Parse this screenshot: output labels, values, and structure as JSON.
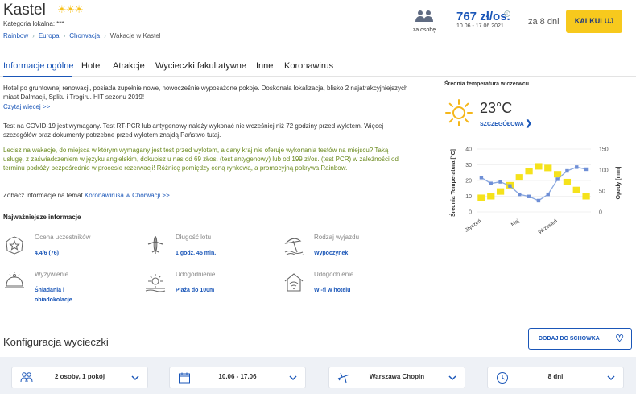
{
  "header": {
    "title": "Kastel",
    "stars": "☀☀☀",
    "category": "Kategoria lokalna: ***",
    "breadcrumb": [
      "Rainbow",
      "Europa",
      "Chorwacja",
      "Wakacje w Kastel"
    ],
    "persons_label": "za osobę",
    "price": "767 zł/os.",
    "dates": "10.06 - 17.06.2021",
    "days": "za 8 dni",
    "calc_button": "KALKULUJ"
  },
  "tabs": [
    "Informacje ogólne",
    "Hotel",
    "Atrakcje",
    "Wycieczki fakultatywne",
    "Inne",
    "Koronawirus"
  ],
  "info": {
    "para1": "Hotel po gruntownej renowacji, posiada zupełnie nowe, nowocześnie wyposażone pokoje. Doskonała lokalizacja, blisko 2 najatrakcyjniejszych miast Dalmacji, Splitu i Trogiru. HIT sezonu 2019!",
    "read_more": "Czytaj więcej >>",
    "para2": "Test na COVID-19 jest wymagany. Test RT-PCR lub antygenowy należy wykonać nie wcześniej niż 72 godziny przed wylotem. Więcej szczegółów oraz dokumenty potrzebne przed wylotem znajdą Państwo tutaj.",
    "para3": "Lecisz na wakacje, do miejsca w którym wymagany jest test przed wylotem, a dany kraj nie oferuje wykonania testów na miejscu? Taką usługę, z zaświadczeniem w języku angielskim, dokupisz u nas od 69 zł/os. (test antygenowy) lub od 199 zł/os. (test PCR) w zależności od terminu podróży bezpośrednio w procesie rezerwacji! Różnicę pomiędzy ceną rynkową, a promocyjną pokrywa Rainbow.",
    "covid_prefix": "Zobacz informacje na temat ",
    "covid_link": "Koronawirusa w Chorwacji >>"
  },
  "key_info": {
    "title": "Najważniejsze informacje",
    "items": [
      {
        "label": "Ocena uczestników",
        "value": "4.4/6 (76)",
        "icon": "star-rating-icon"
      },
      {
        "label": "Długość lotu",
        "value": "1 godz. 45 min.",
        "icon": "airplane-icon"
      },
      {
        "label": "Rodzaj wyjazdu",
        "value": "Wypoczynek",
        "icon": "beach-umbrella-icon"
      },
      {
        "label": "Wyżywienie",
        "value": "Śniadania i obiadokolacje",
        "icon": "food-cloche-icon"
      },
      {
        "label": "Udogodnienie",
        "value": "Plaża do 100m",
        "icon": "beach-sun-icon"
      },
      {
        "label": "Udogodnienie",
        "value": "Wi-fi w hotelu",
        "icon": "wifi-house-icon"
      }
    ]
  },
  "weather": {
    "title": "Średnia temperatura w czerwcu",
    "temperature": "23°C",
    "details_link": "SZCZEGÓŁOWA"
  },
  "chart_data": {
    "type": "bar",
    "categories": [
      "1",
      "2",
      "3",
      "4",
      "5",
      "6",
      "7",
      "8",
      "9",
      "10",
      "11",
      "12"
    ],
    "tick_labels": [
      "Styczeń",
      "Maj",
      "Wrzesień"
    ],
    "tick_positions": [
      1,
      5,
      9
    ],
    "ylabel_left": "Średnia Temperatura [°C]",
    "ylabel_right": "Opady [mm]",
    "ylim_left": [
      0,
      40
    ],
    "ylim_right": [
      0,
      150
    ],
    "yticks_left": [
      0,
      10,
      20,
      30,
      40
    ],
    "yticks_right": [
      0,
      50,
      100,
      150
    ],
    "series": [
      {
        "type": "bar",
        "axis": "left",
        "color": "#f5e21b",
        "values": [
          9,
          10,
          13,
          17,
          22,
          26,
          29,
          28,
          24,
          19,
          14,
          10
        ]
      },
      {
        "type": "line",
        "axis": "right",
        "color": "#8aa8e0",
        "values": [
          82,
          68,
          72,
          62,
          42,
          37,
          27,
          42,
          78,
          98,
          107,
          102
        ]
      }
    ]
  },
  "config": {
    "title": "Konfiguracja wycieczki",
    "add_button": "DODAJ DO SCHOWKA",
    "selectors": [
      "2 osoby, 1 pokój",
      "10.06 - 17.06",
      "Warszawa Chopin",
      "8 dni"
    ]
  },
  "colors": {
    "accent": "#1a56b8",
    "button": "#f7c91d",
    "bars": "#f5e21b",
    "line": "#8aa8e0"
  }
}
